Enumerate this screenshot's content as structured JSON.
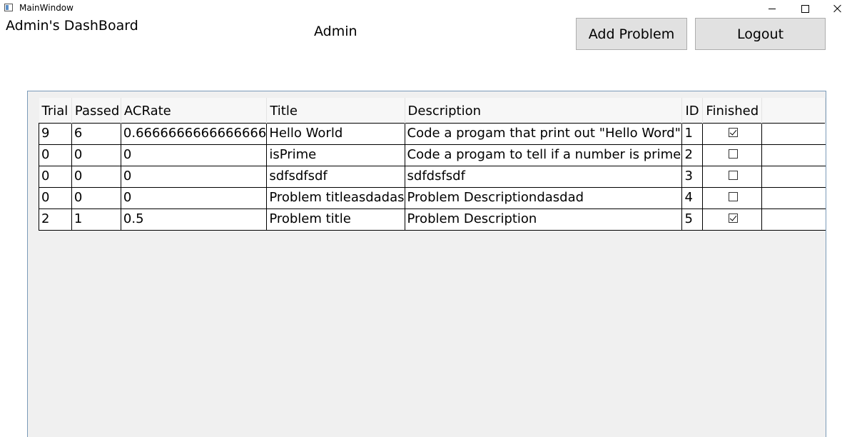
{
  "window": {
    "title": "MainWindow",
    "icons": {
      "app": "window-app-icon",
      "minimize": "minimize-icon",
      "maximize": "maximize-icon",
      "close": "close-icon"
    }
  },
  "header": {
    "dashboard_title": "Admin's DashBoard",
    "user_name": "Admin",
    "add_problem_label": "Add Problem",
    "logout_label": "Logout"
  },
  "grid": {
    "columns": [
      "Trial",
      "Passed",
      "ACRate",
      "Title",
      "Description",
      "ID",
      "Finished"
    ],
    "rows": [
      {
        "trial": "9",
        "passed": "6",
        "acrate": "0.6666666666666666",
        "title": "Hello World",
        "description": "Code a progam that print out \"Hello Word\"",
        "id": "1",
        "finished": true
      },
      {
        "trial": "0",
        "passed": "0",
        "acrate": "0",
        "title": "isPrime",
        "description": "Code a progam to tell if a number is prime",
        "id": "2",
        "finished": false
      },
      {
        "trial": "0",
        "passed": "0",
        "acrate": "0",
        "title": "sdfsdfsdf",
        "description": "sdfdsfsdf",
        "id": "3",
        "finished": false
      },
      {
        "trial": "0",
        "passed": "0",
        "acrate": "0",
        "title": "Problem titleasdadas",
        "description": "Problem Descriptiondasdad",
        "id": "4",
        "finished": false
      },
      {
        "trial": "2",
        "passed": "1",
        "acrate": "0.5",
        "title": "Problem title",
        "description": "Problem Description",
        "id": "5",
        "finished": true
      }
    ]
  },
  "colors": {
    "button_bg": "#e1e1e1",
    "button_border": "#adadad",
    "grid_bg": "#f0f0f0",
    "grid_border": "#7a9ab8"
  }
}
